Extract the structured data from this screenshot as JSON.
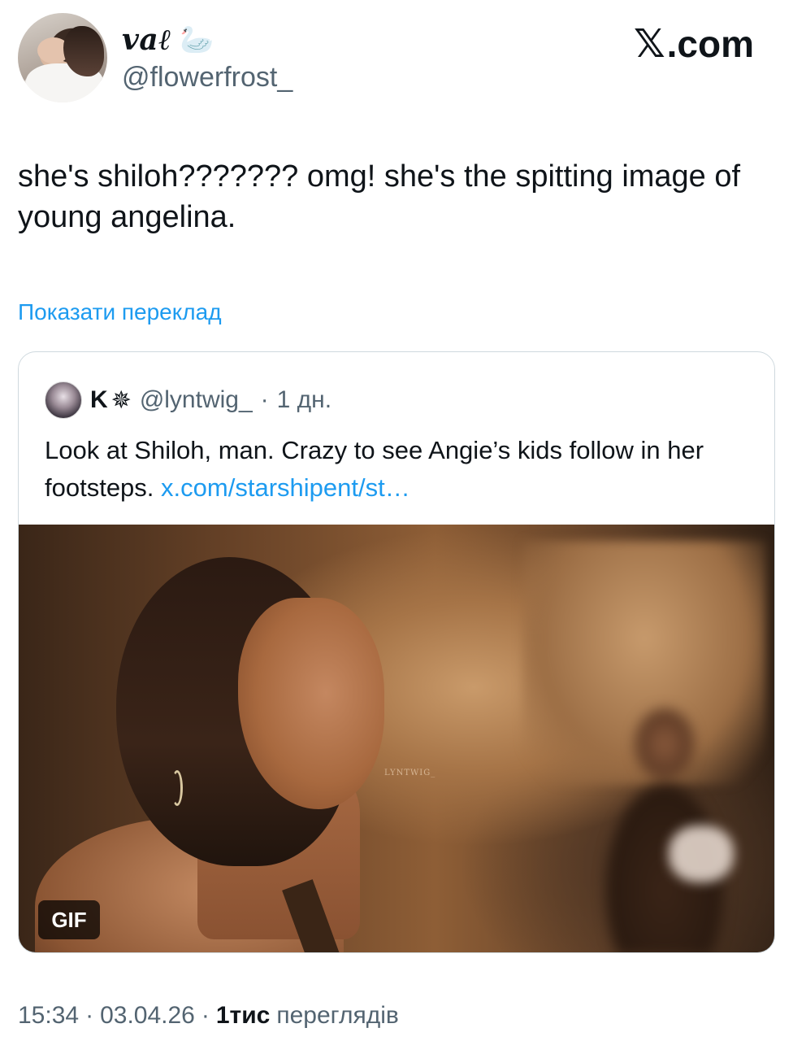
{
  "header": {
    "display_name": "vaℓ",
    "swan_icon": "🦢",
    "handle": "@flowerfrost_",
    "brand": "𝕏.com",
    "brand_x": "𝕏",
    "brand_suffix": ".com"
  },
  "tweet": {
    "text": "she's shiloh??????? omg! she's the spitting image of young angelina.",
    "translate_label": "Показати переклад"
  },
  "quote": {
    "name": "K",
    "name_icon": "✵",
    "handle": "@lyntwig_",
    "separator": "·",
    "time": "1 дн.",
    "text": "Look at Shiloh, man. Crazy to see Angie’s kids follow in her footsteps.",
    "link": "x.com/starshipent/st…",
    "media_watermark": "LYNTWIG_",
    "gif_badge": "GIF"
  },
  "footer": {
    "time": "15:34",
    "sep1": "·",
    "date": "03.04.26",
    "sep2": "·",
    "views_count": "1тис",
    "views_label": "переглядів"
  }
}
